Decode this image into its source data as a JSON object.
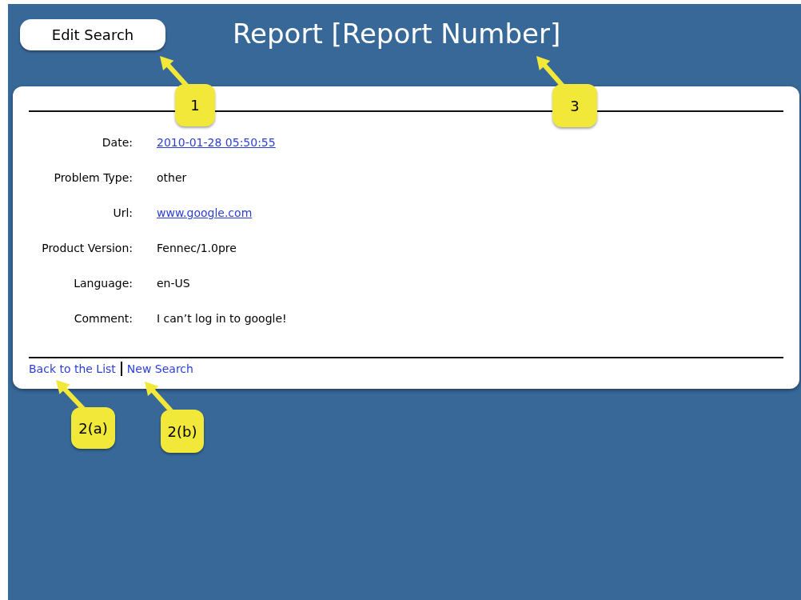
{
  "header": {
    "edit_button": "Edit Search",
    "title": "Report [Report Number]"
  },
  "fields": [
    {
      "label": "Date:",
      "value": "2010-01-28 05:50:55",
      "kind": "link"
    },
    {
      "label": "Problem Type:",
      "value": "other",
      "kind": "text"
    },
    {
      "label": "Url:",
      "value": "www.google.com",
      "kind": "link"
    },
    {
      "label": "Product Version:",
      "value": "Fennec/1.0pre",
      "kind": "text"
    },
    {
      "label": "Language:",
      "value": "en-US",
      "kind": "text"
    },
    {
      "label": "Comment:",
      "value": "I can’t log in to google!",
      "kind": "text"
    }
  ],
  "footer_links": [
    "Back to the List",
    "New Search"
  ],
  "callouts": [
    {
      "label": "1"
    },
    {
      "label": "3"
    },
    {
      "label": "2(a)"
    },
    {
      "label": "2(b)"
    }
  ]
}
